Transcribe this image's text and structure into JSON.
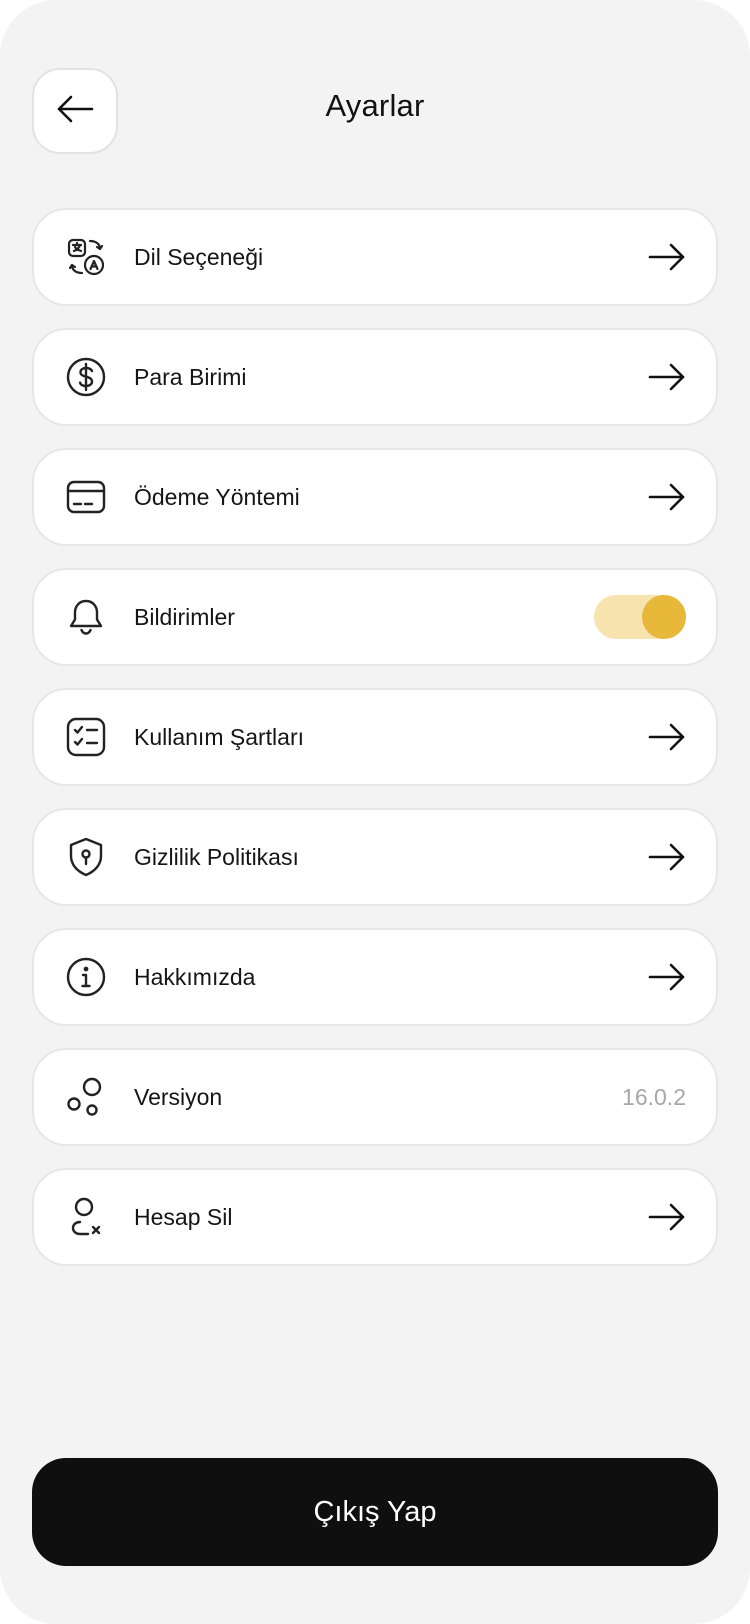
{
  "header": {
    "title": "Ayarlar",
    "back_icon": "arrow-left-icon"
  },
  "settings": {
    "items": [
      {
        "label": "Dil Seçeneği",
        "icon": "language-translate-icon",
        "trailing": "arrow"
      },
      {
        "label": "Para Birimi",
        "icon": "dollar-circle-icon",
        "trailing": "arrow"
      },
      {
        "label": "Ödeme Yöntemi",
        "icon": "credit-card-icon",
        "trailing": "arrow"
      },
      {
        "label": "Bildirimler",
        "icon": "bell-icon",
        "trailing": "toggle",
        "toggle_on": true
      },
      {
        "label": "Kullanım Şartları",
        "icon": "checklist-icon",
        "trailing": "arrow"
      },
      {
        "label": "Gizlilik Politikası",
        "icon": "shield-keyhole-icon",
        "trailing": "arrow"
      },
      {
        "label": "Hakkımızda",
        "icon": "info-circle-icon",
        "trailing": "arrow"
      },
      {
        "label": "Versiyon",
        "icon": "circles-icon",
        "trailing": "value",
        "value": "16.0.2"
      },
      {
        "label": "Hesap Sil",
        "icon": "user-remove-icon",
        "trailing": "arrow"
      }
    ]
  },
  "footer": {
    "logout_label": "Çıkış Yap"
  },
  "colors": {
    "background": "#f3f3f3",
    "card": "#ffffff",
    "toggle_track": "#f7e3ad",
    "toggle_knob": "#e8b83a",
    "logout_bg": "#0f0f0f",
    "muted_text": "#a7a7a7"
  }
}
